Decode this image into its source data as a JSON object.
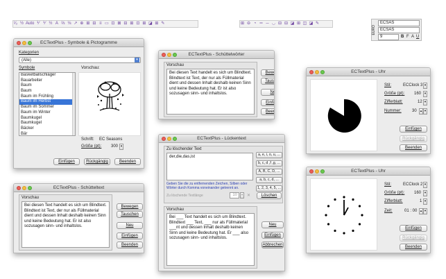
{
  "toolbar_left": {
    "items": [
      "¹⁄₂",
      "½",
      "Auto",
      "⅟",
      "⅟",
      "½",
      "A",
      "⅔",
      "⅛",
      "↗",
      "⊕",
      "⊞",
      "⊟",
      "≡",
      "▭",
      "⊡",
      "⊠",
      "⊟",
      "⊞",
      "⊡",
      "⊞",
      "◪",
      "⊞",
      "✎"
    ]
  },
  "toolbar_mid": {
    "items": [
      "⊞",
      "⊖",
      "◔",
      "═",
      "─",
      "◡",
      "⊟",
      "⊟",
      "◪",
      "⊞",
      "◫",
      "◪",
      "✎"
    ]
  },
  "font_panel": {
    "font1": "ECSAS",
    "font2": "ECSAS",
    "size": "9",
    "side_label": "EURO",
    "style_b": "B",
    "style_i": "F",
    "style_u": "U",
    "style_size": "A"
  },
  "symbols": {
    "title": "ECTextPlus - Symbole & Pictogramme",
    "kategorien_label": "Kategorien",
    "kategorie_value": "(Alle)",
    "symbole_label": "Symbole",
    "vorschau_label": "Vorschau:",
    "items": [
      "Basketballschläger",
      "Bauarbeiter",
      "Baum",
      "Baum",
      "Baum im Frühling",
      "Baum im Herbst",
      "Baum im Sommer",
      "Baum im Winter",
      "Baumkugel",
      "Baumkugel",
      "Bäcker",
      "Bär",
      "Bäume"
    ],
    "selected_index": 5,
    "schrift_label": "Schrift:",
    "schrift_value": "EC Seasons",
    "groesse_label": "Größe (pt):",
    "groesse_value": "300",
    "btn_insert": "Einfügen",
    "btn_undo": "Rückgängig",
    "btn_close": "Beenden"
  },
  "shaker": {
    "title": "ECTextPlus - Schüttelwörter",
    "vorschau_label": "Vorschau",
    "text": "Bei diesen Text handelt es sich um Blindtext. Blindtext ist Text, der nur als Füllmaterial dient und dessen Inhalt deshalb keinen Sinn und keine Bedeutung hat. Er ist also sozusagen sinn- und inhaltslos.",
    "btn_move": "Bewegen",
    "btn_swap": "Tauschen",
    "btn_new": "Neu",
    "btn_insert": "Einfügen",
    "btn_close": "Beenden"
  },
  "clock1": {
    "title": "ECTextPlus - Uhr",
    "stil_label": "Stil:",
    "stil_value": "ECClock 3",
    "groesse_label": "Größe (pt):",
    "groesse_value": "160",
    "ziffer_label": "Zifferblatt:",
    "ziffer_value": "12",
    "nummer_label": "Nummer:",
    "nummer_value": "30",
    "btn_insert": "Einfügen",
    "btn_undo": "Rückgängig",
    "btn_close": "Beenden"
  },
  "gaps": {
    "title": "ECTextPlus - Lückentext",
    "delete_label": "Zu löschender Text",
    "delete_text": "der,die,das,ist",
    "hint": "Geben Sie die zu entfernenden Zeichen, Silben oder Wörter durch Komma voneinander getrennt an.",
    "length_label": "Zu löschende Textlänge",
    "length_value": "10",
    "btn_delete": "Löschen",
    "tokens": [
      "a, e, i, o, u, ...",
      "b, c, d ,f ,g, ...",
      "A, B, C, D, ...",
      "a, b, c, d, ...",
      "1, 2, 3, 4, 5, ..."
    ],
    "vorschau_label": "Vorschau",
    "preview": "Bei ___ Text handelt es sich um Blindtext. Blindtext ___ Text, ___ nur als Füllmaterial ___nt und dessen Inhalt deshalb keinen Sinn und keine Bedeutung hat. Er ___ also sozusagen sinn- und inhaltslos.",
    "btn_new": "Neu",
    "btn_insert": "Einfügen",
    "btn_cancel": "Abbrechen"
  },
  "shaketext": {
    "title": "ECTextPlus - Schütteltext",
    "vorschau_label": "Vorschau",
    "text": "Bei diesen Text handelt es sich um Blindtext. Blindtext ist Text, der nur als Füllmaterial dient und dessen Inhalt deshalb keinen Sinn und keine Bedeutung hat. Er ist also sozusagen sinn- und inhaltslos.",
    "btn_move": "Bewegen",
    "btn_swap": "Tauschen",
    "btn_new": "Neu",
    "btn_insert": "Einfügen",
    "btn_close": "Beenden"
  },
  "clock2": {
    "title": "ECTextPlus - Uhr",
    "stil_label": "Stil:",
    "stil_value": "ECClock 2",
    "groesse_label": "Größe (pt):",
    "groesse_value": "160",
    "ziffer_label": "Zifferblatt:",
    "ziffer_value": "1",
    "zeit_label": "Zeit:",
    "zeit_value": "01 : 00",
    "btn_insert": "Einfügen",
    "btn_undo": "Rückgängig",
    "btn_close": "Beenden"
  }
}
